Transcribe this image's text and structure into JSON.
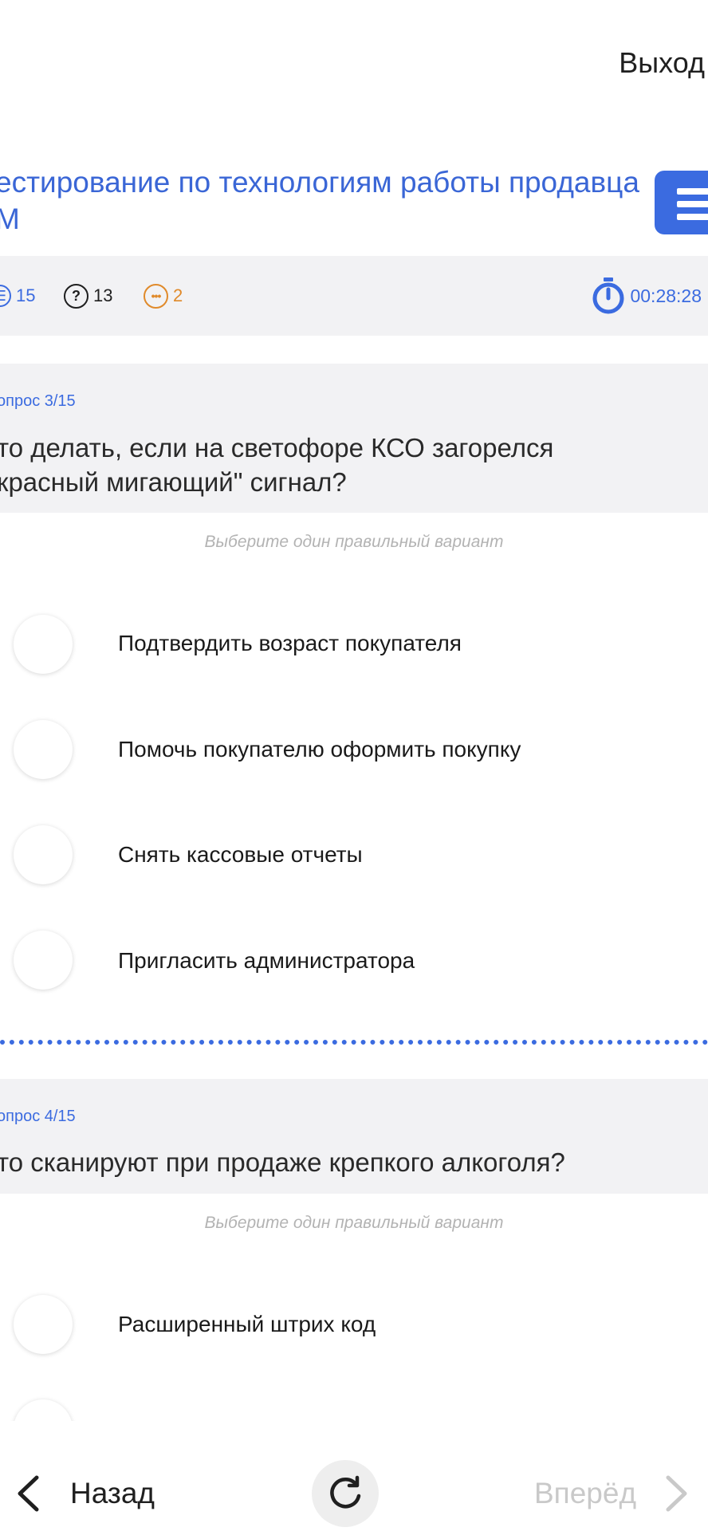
{
  "header": {
    "exit_label": "Выход",
    "title_line1": "естирование по технологиям работы продавца",
    "title_line2": "M"
  },
  "stats": {
    "total": "15",
    "unanswered": "13",
    "skipped": "2",
    "timer": "00:28:28"
  },
  "questions": [
    {
      "number": "опрос 3/15",
      "text_line1": "то делать, если на светофоре КСО загорелся",
      "text_line2": "красный мигающий\" сигнал?",
      "hint": "Выберите один правильный вариант",
      "options": [
        "Подтвердить возраст покупателя",
        "Помочь покупателю оформить покупку",
        "Снять кассовые отчеты",
        "Пригласить администратора"
      ]
    },
    {
      "number": "опрос 4/15",
      "text_line1": "то сканируют при продаже крепкого алкоголя?",
      "hint": "Выберите один правильный вариант",
      "options": [
        "Расширенный штрих код"
      ]
    }
  ],
  "nav": {
    "back_label": "Назад",
    "next_label": "Вперёд"
  },
  "colors": {
    "accent": "#3b6be0",
    "skipped": "#e08a2a",
    "panel": "#f2f2f4"
  }
}
